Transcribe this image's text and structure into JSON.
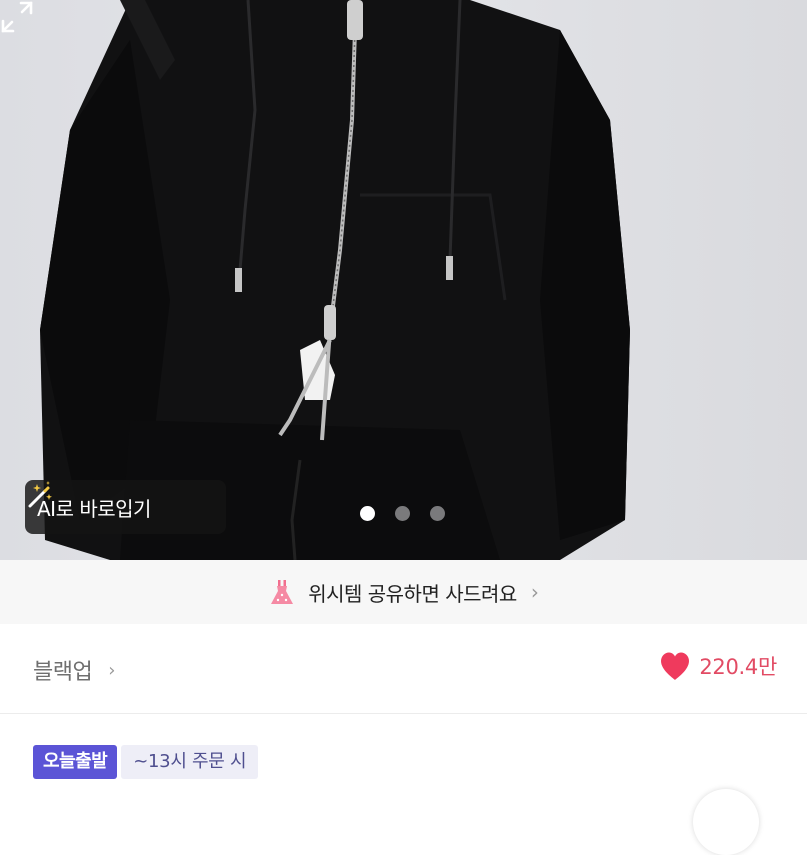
{
  "hero": {
    "ai_try_on_label": "AI로 바로입기",
    "slide_count": 3,
    "active_slide": 1
  },
  "share_banner": {
    "text": "위시템 공유하면 사드려요"
  },
  "brand": {
    "name": "블랙업"
  },
  "likes": {
    "count": "220.4만",
    "color": "#e24b64"
  },
  "badges": {
    "shipping": "오늘출발",
    "cutoff": "~13시 주문 시"
  },
  "colors": {
    "badge_purple": "#5b54d6",
    "heart_red": "#ef3a5d"
  }
}
